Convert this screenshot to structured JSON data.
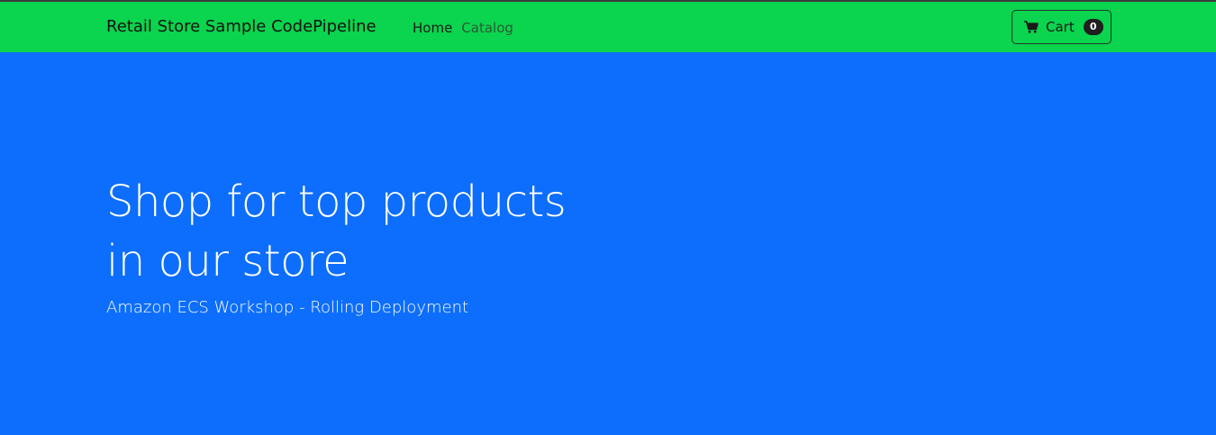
{
  "navbar": {
    "brand": "Retail Store Sample CodePipeline",
    "links": [
      {
        "label": "Home"
      },
      {
        "label": "Catalog"
      }
    ],
    "cart": {
      "label": "Cart",
      "count": "0",
      "icon": "cart-icon"
    }
  },
  "hero": {
    "title_line1": "Shop for top products",
    "title_line2": "in our store",
    "subtitle": "Amazon ECS Workshop - Rolling Deployment"
  },
  "colors": {
    "navbar_bg": "#0bd44e",
    "hero_bg": "#0d6efd",
    "badge_bg": "#1f1f1f"
  }
}
